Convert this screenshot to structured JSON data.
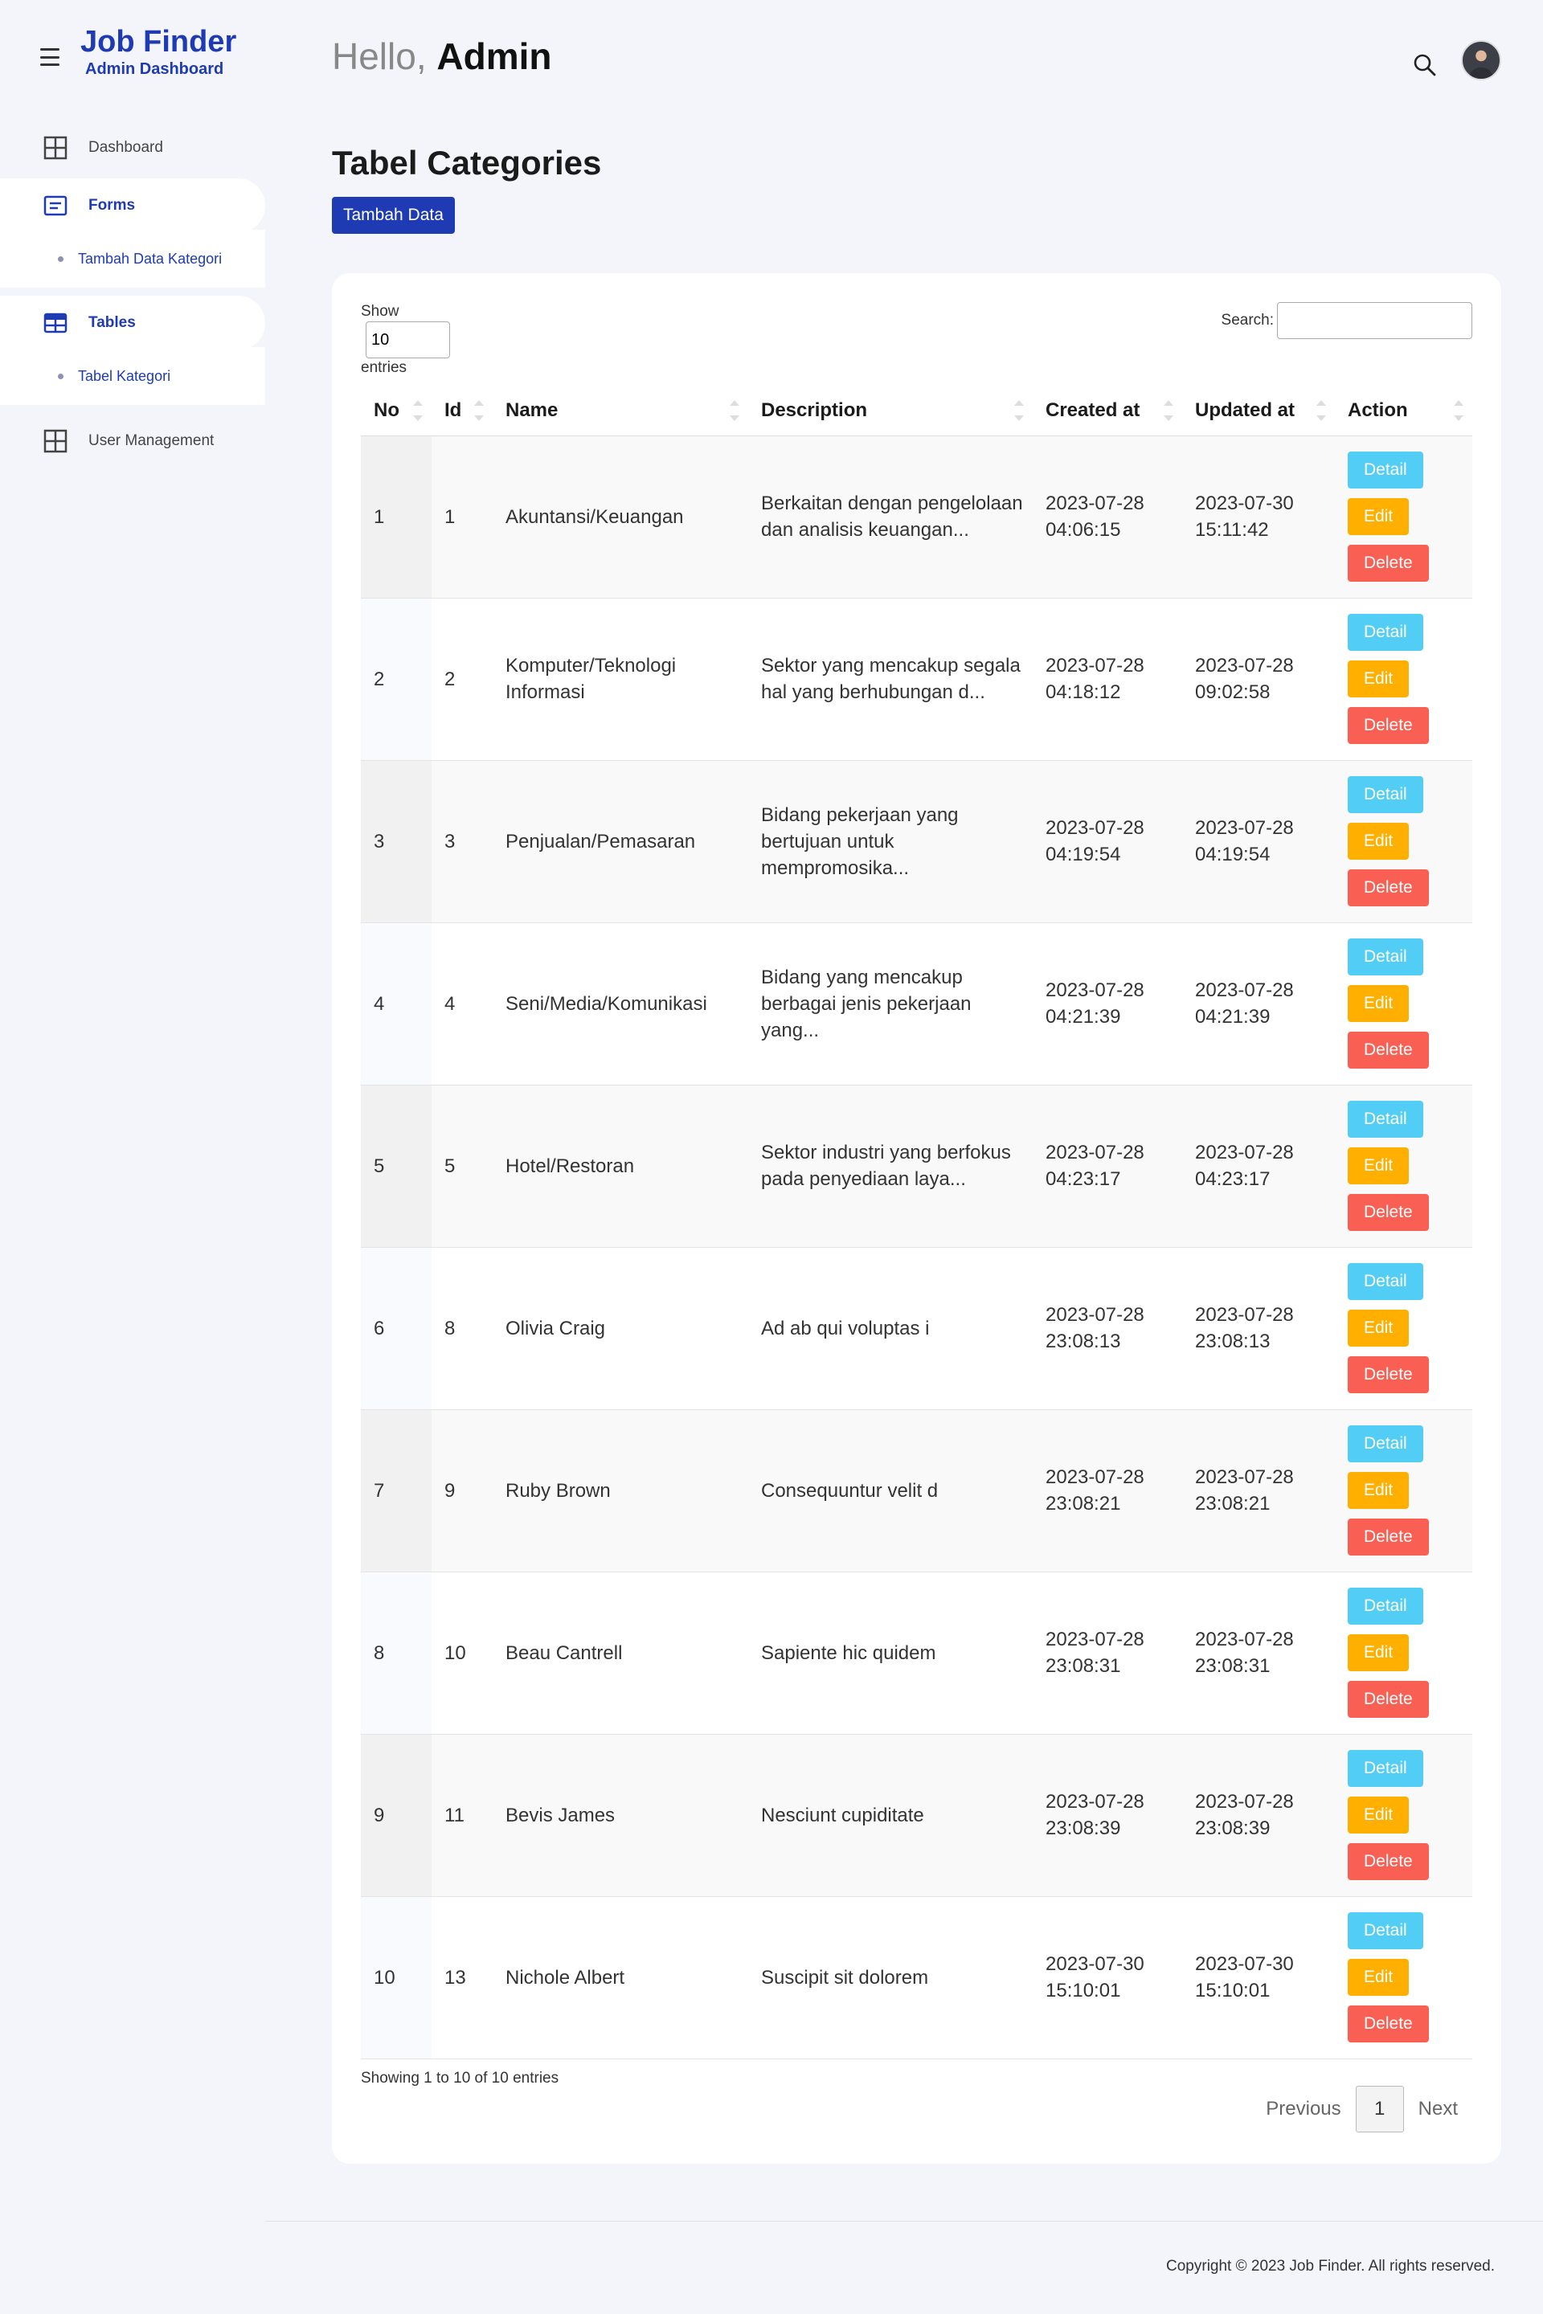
{
  "brand": {
    "title": "Job Finder",
    "subtitle": "Admin Dashboard"
  },
  "header": {
    "greeting": "Hello, ",
    "user": "Admin"
  },
  "sidebar": {
    "items": [
      {
        "label": "Dashboard",
        "icon": "grid-icon"
      },
      {
        "label": "Forms",
        "icon": "form-icon",
        "sub": "Tambah Data Kategori"
      },
      {
        "label": "Tables",
        "icon": "table-icon",
        "sub": "Tabel Kategori"
      },
      {
        "label": "User Management",
        "icon": "grid-icon"
      }
    ]
  },
  "page": {
    "title": "Tabel Categories",
    "add_button": "Tambah Data"
  },
  "table_controls": {
    "show_label": "Show",
    "entries_value": "10",
    "entries_label": "entries",
    "search_label": "Search:"
  },
  "table": {
    "columns": [
      "No",
      "Id",
      "Name",
      "Description",
      "Created at",
      "Updated at",
      "Action"
    ],
    "rows": [
      {
        "no": "1",
        "id": "1",
        "name": "Akuntansi/Keuangan",
        "description": "Berkaitan dengan pengelolaan dan analisis keuangan...",
        "created_date": "2023-07-28",
        "created_time": "04:06:15",
        "updated_date": "2023-07-30",
        "updated_time": "15:11:42"
      },
      {
        "no": "2",
        "id": "2",
        "name": "Komputer/Teknologi Informasi",
        "description": "Sektor yang mencakup segala hal yang berhubungan d...",
        "created_date": "2023-07-28",
        "created_time": "04:18:12",
        "updated_date": "2023-07-28",
        "updated_time": "09:02:58"
      },
      {
        "no": "3",
        "id": "3",
        "name": "Penjualan/Pemasaran",
        "description": "Bidang pekerjaan yang bertujuan untuk mempromosika...",
        "created_date": "2023-07-28",
        "created_time": "04:19:54",
        "updated_date": "2023-07-28",
        "updated_time": "04:19:54"
      },
      {
        "no": "4",
        "id": "4",
        "name": "Seni/Media/Komunikasi",
        "description": "Bidang yang mencakup berbagai jenis pekerjaan yang...",
        "created_date": "2023-07-28",
        "created_time": "04:21:39",
        "updated_date": "2023-07-28",
        "updated_time": "04:21:39"
      },
      {
        "no": "5",
        "id": "5",
        "name": "Hotel/Restoran",
        "description": "Sektor industri yang berfokus pada penyediaan laya...",
        "created_date": "2023-07-28",
        "created_time": "04:23:17",
        "updated_date": "2023-07-28",
        "updated_time": "04:23:17"
      },
      {
        "no": "6",
        "id": "8",
        "name": "Olivia Craig",
        "description": "Ad ab qui voluptas i",
        "created_date": "2023-07-28",
        "created_time": "23:08:13",
        "updated_date": "2023-07-28",
        "updated_time": "23:08:13"
      },
      {
        "no": "7",
        "id": "9",
        "name": "Ruby Brown",
        "description": "Consequuntur velit d",
        "created_date": "2023-07-28",
        "created_time": "23:08:21",
        "updated_date": "2023-07-28",
        "updated_time": "23:08:21"
      },
      {
        "no": "8",
        "id": "10",
        "name": "Beau Cantrell",
        "description": "Sapiente hic quidem",
        "created_date": "2023-07-28",
        "created_time": "23:08:31",
        "updated_date": "2023-07-28",
        "updated_time": "23:08:31"
      },
      {
        "no": "9",
        "id": "11",
        "name": "Bevis James",
        "description": "Nesciunt cupiditate",
        "created_date": "2023-07-28",
        "created_time": "23:08:39",
        "updated_date": "2023-07-28",
        "updated_time": "23:08:39"
      },
      {
        "no": "10",
        "id": "13",
        "name": "Nichole Albert",
        "description": "Suscipit sit dolorem",
        "created_date": "2023-07-30",
        "created_time": "15:10:01",
        "updated_date": "2023-07-30",
        "updated_time": "15:10:01"
      }
    ],
    "action_labels": {
      "detail": "Detail",
      "edit": "Edit",
      "delete": "Delete"
    }
  },
  "pagination": {
    "info": "Showing 1 to 10 of 10 entries",
    "previous": "Previous",
    "current": "1",
    "next": "Next"
  },
  "footer": {
    "copyright": "Copyright © 2023 Job Finder. All rights reserved."
  },
  "colors": {
    "brand": "#1f3bb3",
    "detail": "#52cdf5",
    "edit": "#ffaf00",
    "delete": "#f95f53"
  }
}
